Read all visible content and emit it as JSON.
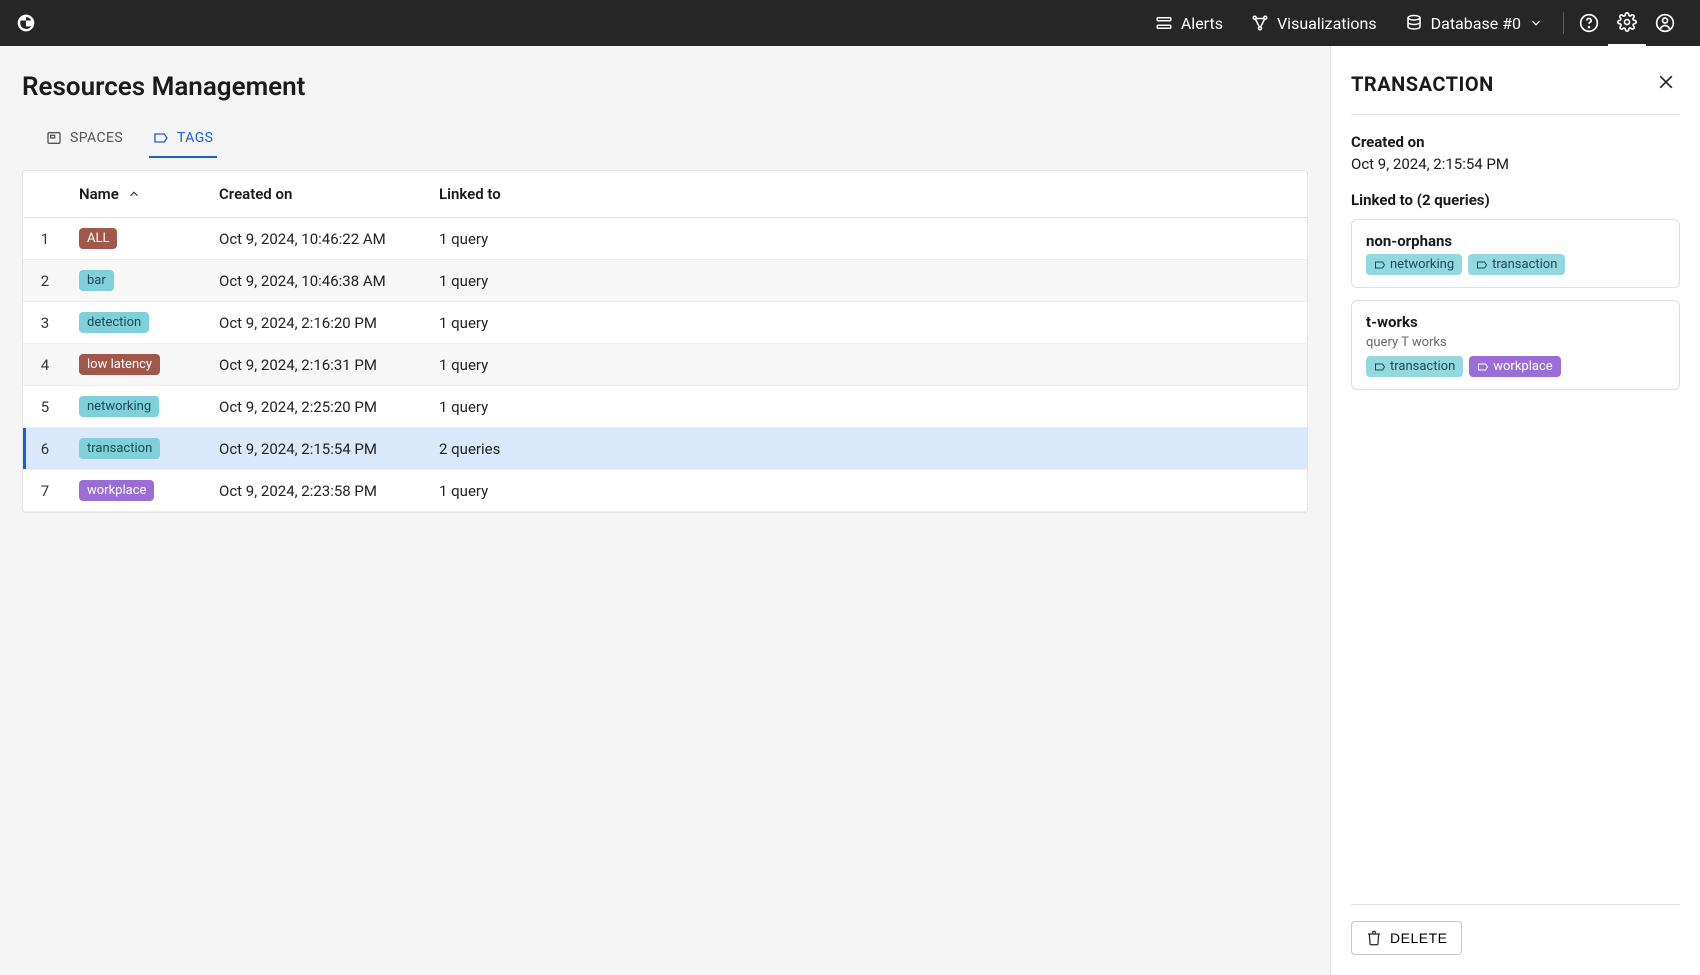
{
  "topbar": {
    "alerts": "Alerts",
    "visualizations": "Visualizations",
    "database": "Database #0"
  },
  "page": {
    "title": "Resources Management"
  },
  "tabs": {
    "spaces": "SPACES",
    "tags": "TAGS"
  },
  "table": {
    "headers": {
      "name": "Name",
      "created": "Created on",
      "linked": "Linked to"
    },
    "rows": [
      {
        "idx": "1",
        "tag": "ALL",
        "color": "brown",
        "created": "Oct 9, 2024, 10:46:22 AM",
        "linked": "1 query",
        "selected": false
      },
      {
        "idx": "2",
        "tag": "bar",
        "color": "teal",
        "created": "Oct 9, 2024, 10:46:38 AM",
        "linked": "1 query",
        "selected": false
      },
      {
        "idx": "3",
        "tag": "detection",
        "color": "teal",
        "created": "Oct 9, 2024, 2:16:20 PM",
        "linked": "1 query",
        "selected": false
      },
      {
        "idx": "4",
        "tag": "low latency",
        "color": "brown",
        "created": "Oct 9, 2024, 2:16:31 PM",
        "linked": "1 query",
        "selected": false
      },
      {
        "idx": "5",
        "tag": "networking",
        "color": "teal",
        "created": "Oct 9, 2024, 2:25:20 PM",
        "linked": "1 query",
        "selected": false
      },
      {
        "idx": "6",
        "tag": "transaction",
        "color": "teal",
        "created": "Oct 9, 2024, 2:15:54 PM",
        "linked": "2 queries",
        "selected": true
      },
      {
        "idx": "7",
        "tag": "workplace",
        "color": "purple",
        "created": "Oct 9, 2024, 2:23:58 PM",
        "linked": "1 query",
        "selected": false
      }
    ]
  },
  "sidepanel": {
    "title": "TRANSACTION",
    "created_label": "Created on",
    "created_value": "Oct 9, 2024, 2:15:54 PM",
    "linked_header": "Linked to (2 queries)",
    "linked": [
      {
        "title": "non-orphans",
        "subtitle": "",
        "tags": [
          {
            "label": "networking",
            "color": "teal"
          },
          {
            "label": "transaction",
            "color": "teal"
          }
        ]
      },
      {
        "title": "t-works",
        "subtitle": "query T works",
        "tags": [
          {
            "label": "transaction",
            "color": "teal"
          },
          {
            "label": "workplace",
            "color": "purple"
          }
        ]
      }
    ],
    "delete_label": "DELETE"
  }
}
